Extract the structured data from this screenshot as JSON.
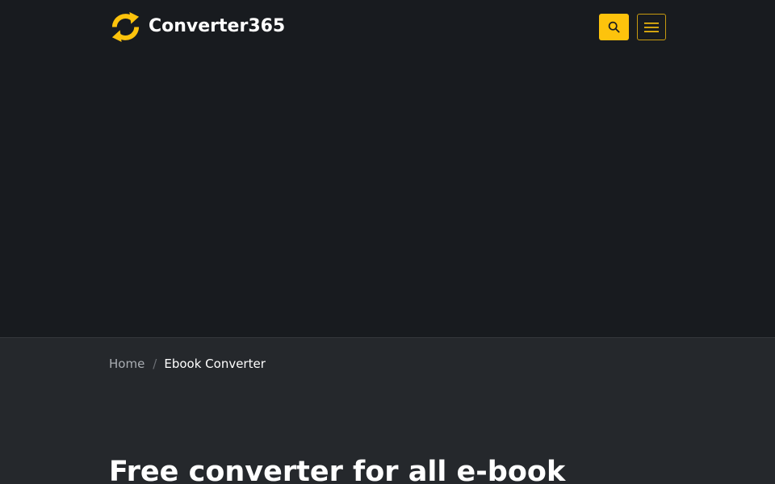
{
  "brand": {
    "name": "Converter365",
    "logo_icon": "sync-arrows-icon"
  },
  "header": {
    "search_icon": "search-icon",
    "menu_icon": "hamburger-menu-icon"
  },
  "breadcrumb": {
    "home": "Home",
    "separator": "/",
    "current": "Ebook Converter"
  },
  "main": {
    "title": "Free converter for all e-book"
  },
  "colors": {
    "accent": "#fdc30c",
    "header_bg": "#181b1f",
    "page_bg": "#25282c",
    "text": "#ffffff",
    "muted": "#a9adb2"
  }
}
